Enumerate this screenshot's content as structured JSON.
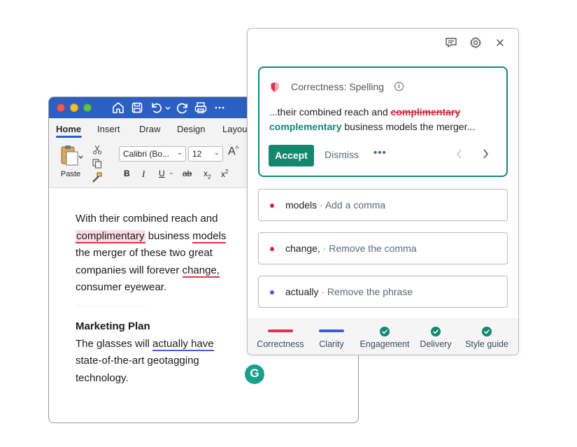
{
  "word": {
    "tabs": [
      "Home",
      "Insert",
      "Draw",
      "Design",
      "Layou"
    ],
    "paste_label": "Paste",
    "font_name": "Calibri (Bo...",
    "font_size": "12",
    "format_buttons": [
      "B",
      "I",
      "U",
      "ab",
      "x",
      "x"
    ],
    "doc": {
      "p1_l1": "With their combined reach and",
      "p1_l2a": "complimentary",
      "p1_l2b": " business ",
      "p1_l2c": "models",
      "p1_l3": "the merger of these two great",
      "p1_l4a": "companies will forever ",
      "p1_l4b": "change",
      "p1_l4c": ",",
      "p1_l5": "consumer eyewear.",
      "heading": "Marketing Plan",
      "p2_l1a": "The glasses will ",
      "p2_l1b": "actually have",
      "p2_l2": "state-of-the-art geotagging",
      "p2_l3": "technology."
    }
  },
  "grammarly": {
    "logo_letter": "G",
    "main_card": {
      "category": "Correctness: Spelling",
      "info": "i",
      "text_prefix": "...their combined reach and ",
      "wrong_word": "complimentary",
      "correct_word": "complementary",
      "text_suffix": " business models the merger...",
      "accept_label": "Accept",
      "dismiss_label": "Dismiss",
      "more_label": "•••"
    },
    "suggestions": [
      {
        "word": "models",
        "sep": " · ",
        "action": "Add a comma",
        "color": "#d6243a"
      },
      {
        "word": "change,",
        "sep": " · ",
        "action": "Remove the comma",
        "color": "#d6243a"
      },
      {
        "word": "actually",
        "sep": " · ",
        "action": "Remove the phrase",
        "color": "#3b5fd6"
      }
    ],
    "footer": [
      {
        "label": "Correctness",
        "indicator": "bar",
        "color": "#e2334a"
      },
      {
        "label": "Clarity",
        "indicator": "bar",
        "color": "#3b5fd6"
      },
      {
        "label": "Engagement",
        "indicator": "check",
        "color": "#15876e"
      },
      {
        "label": "Delivery",
        "indicator": "check",
        "color": "#15876e"
      },
      {
        "label": "Style guide",
        "indicator": "check",
        "color": "#15876e"
      }
    ]
  }
}
